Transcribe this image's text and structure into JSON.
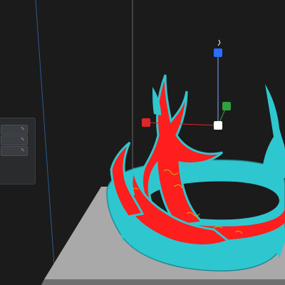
{
  "viewport": {
    "background_color": "#1b1b1b",
    "build_plate_color": "#a9a9a9",
    "model_color_outer": "#2fc7cf",
    "model_color_surface": "#ff1e1e",
    "model_color_detail": "#c8b300",
    "gizmo": {
      "x_axis_color": "#e0262a",
      "y_axis_color": "#2fa13e",
      "z_axis_color": "#2a6dff",
      "center_color": "#ffffff"
    }
  },
  "side_panel": {
    "fields": [
      {
        "value": "",
        "icon": "edit-stepper-icon"
      },
      {
        "value": "",
        "icon": "edit-stepper-icon"
      },
      {
        "value": "",
        "icon": "edit-stepper-icon"
      }
    ]
  }
}
